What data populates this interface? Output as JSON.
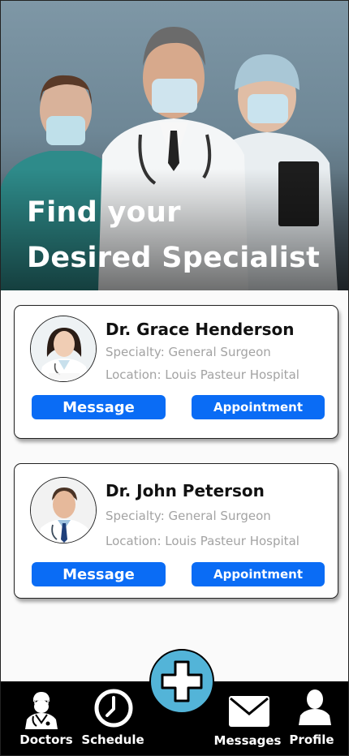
{
  "hero": {
    "title_line1": "Find your",
    "title_line2": "Desired Specialist"
  },
  "doctors": [
    {
      "name": "Dr. Grace Henderson",
      "specialty": "Specialty: General Surgeon",
      "location": "Location: Louis Pasteur Hospital",
      "message_label": "Message",
      "appointment_label": "Appointment"
    },
    {
      "name": "Dr. John Peterson",
      "specialty": "Specialty: General Surgeon",
      "location": "Location: Louis Pasteur Hospital",
      "message_label": "Message",
      "appointment_label": "Appointment"
    }
  ],
  "nav": {
    "items": [
      {
        "label": "Doctors",
        "icon": "doctor-icon"
      },
      {
        "label": "Schedule",
        "icon": "clock-icon"
      },
      {
        "label": "Messages",
        "icon": "envelope-icon"
      },
      {
        "label": "Profile",
        "icon": "user-icon"
      }
    ],
    "fab_icon": "plus-icon"
  },
  "colors": {
    "primary_button": "#0a6cf5",
    "fab": "#53b4d8",
    "nav_background": "#000000",
    "meta_text": "#a3a3a3"
  }
}
